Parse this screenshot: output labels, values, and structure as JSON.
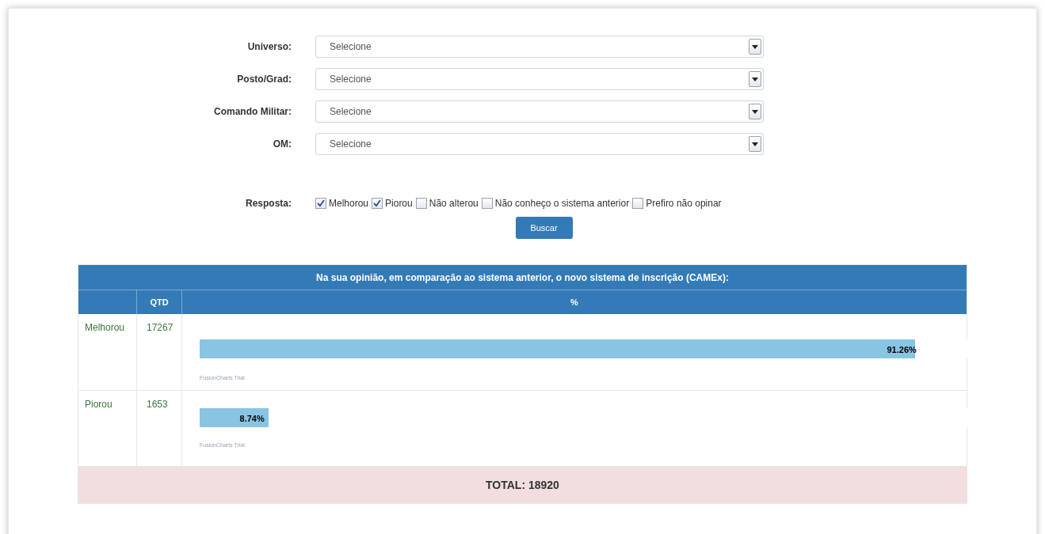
{
  "filters": [
    {
      "label": "Universo:",
      "value": "Selecione"
    },
    {
      "label": "Posto/Grad:",
      "value": "Selecione"
    },
    {
      "label": "Comando Militar:",
      "value": "Selecione"
    },
    {
      "label": "OM:",
      "value": "Selecione"
    }
  ],
  "resposta": {
    "label": "Resposta:",
    "options": [
      {
        "label": "Melhorou",
        "checked": true
      },
      {
        "label": "Piorou",
        "checked": true
      },
      {
        "label": "Não alterou",
        "checked": false
      },
      {
        "label": "Não conheço o sistema anterior",
        "checked": false
      },
      {
        "label": "Prefiro não opinar",
        "checked": false
      }
    ]
  },
  "search_button": "Buscar",
  "table": {
    "title": "Na sua opinião, em comparação ao sistema anterior, o novo sistema de inscrição (CAMEx):",
    "columns": [
      "QTD",
      "%"
    ],
    "rows": [
      {
        "answer": "Melhorou",
        "qtd": "17267",
        "level": 0.9126,
        "reading": "91.26%",
        "note": "FusionCharts Trial"
      },
      {
        "answer": "Piorou",
        "qtd": "1653",
        "level": 0.0874,
        "reading": "8.74%",
        "note": "FusionCharts Trial"
      }
    ],
    "total": "TOTAL: 18920"
  }
}
